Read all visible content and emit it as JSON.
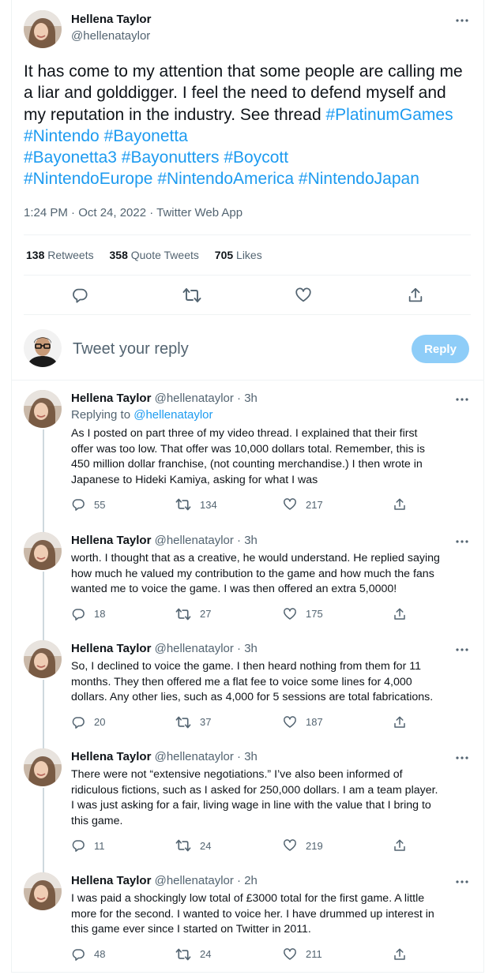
{
  "main_tweet": {
    "author_name": "Hellena Taylor",
    "author_handle": "@hellenataylor",
    "text_plain": "It has come to my attention that some people are calling me a liar and golddigger. I feel the need to defend myself and my reputation in the industry.  See thread ",
    "hashtags": [
      "#PlatinumGames",
      "#Nintendo",
      "#Bayonetta",
      "#Bayonetta3",
      "#Bayonutters",
      "#Boycott",
      "#NintendoEurope",
      "#NintendoAmerica",
      "#NintendoJapan"
    ],
    "timestamp": "1:24 PM · Oct 24, 2022 · Twitter Web App",
    "retweets_count": "138",
    "retweets_label": "Retweets",
    "quotes_count": "358",
    "quotes_label": "Quote Tweets",
    "likes_count": "705",
    "likes_label": "Likes"
  },
  "composer": {
    "placeholder": "Tweet your reply",
    "reply_button": "Reply"
  },
  "replies": [
    {
      "name": "Hellena Taylor",
      "handle": "@hellenataylor · 3h",
      "replying_prefix": "Replying to ",
      "replying_handle": "@hellenataylor",
      "lines": [
        "As I posted on part three of my video thread.  I explained that their first",
        "offer was too low.  That offer was 10,000 dollars total.  Remember, this is",
        "450 million dollar franchise, (not counting merchandise.)  I then wrote in",
        "Japanese to Hideki Kamiya, asking for what I was"
      ],
      "replies": "55",
      "retweets": "134",
      "likes": "217"
    },
    {
      "name": "Hellena Taylor",
      "handle": "@hellenataylor · 3h",
      "lines": [
        "worth.  I thought that as a creative, he would understand.  He replied saying",
        "how much he valued my contribution to the game and how much the fans",
        "wanted me to voice the game.  I was then offered an extra 5,0000!"
      ],
      "replies": "18",
      "retweets": "27",
      "likes": "175"
    },
    {
      "name": "Hellena Taylor",
      "handle": "@hellenataylor · 3h",
      "lines": [
        "So, I declined to voice the game.  I then heard nothing from them for 11",
        "months.  They then offered me a flat fee to voice some lines for 4,000",
        "dollars.  Any other lies, such as 4,000 for 5 sessions are total fabrications."
      ],
      "replies": "20",
      "retweets": "37",
      "likes": "187"
    },
    {
      "name": "Hellena Taylor",
      "handle": "@hellenataylor · 3h",
      "lines": [
        "There were not “extensive negotiations.”  I’ve also been informed of",
        "ridiculous fictions, such as I asked for 250,000 dollars.  I am a team player.",
        "I was just asking for a fair, living wage in line with the value that I bring to",
        "this game."
      ],
      "replies": "11",
      "retweets": "24",
      "likes": "219"
    },
    {
      "name": "Hellena Taylor",
      "handle": "@hellenataylor · 2h",
      "lines": [
        "I was paid a shockingly low total of £3000 total for the first game.  A little",
        "more for the second.  I wanted to voice her.  I have drummed up interest in",
        "this game ever since I started on Twitter in 2011."
      ],
      "replies": "48",
      "retweets": "24",
      "likes": "211"
    }
  ]
}
